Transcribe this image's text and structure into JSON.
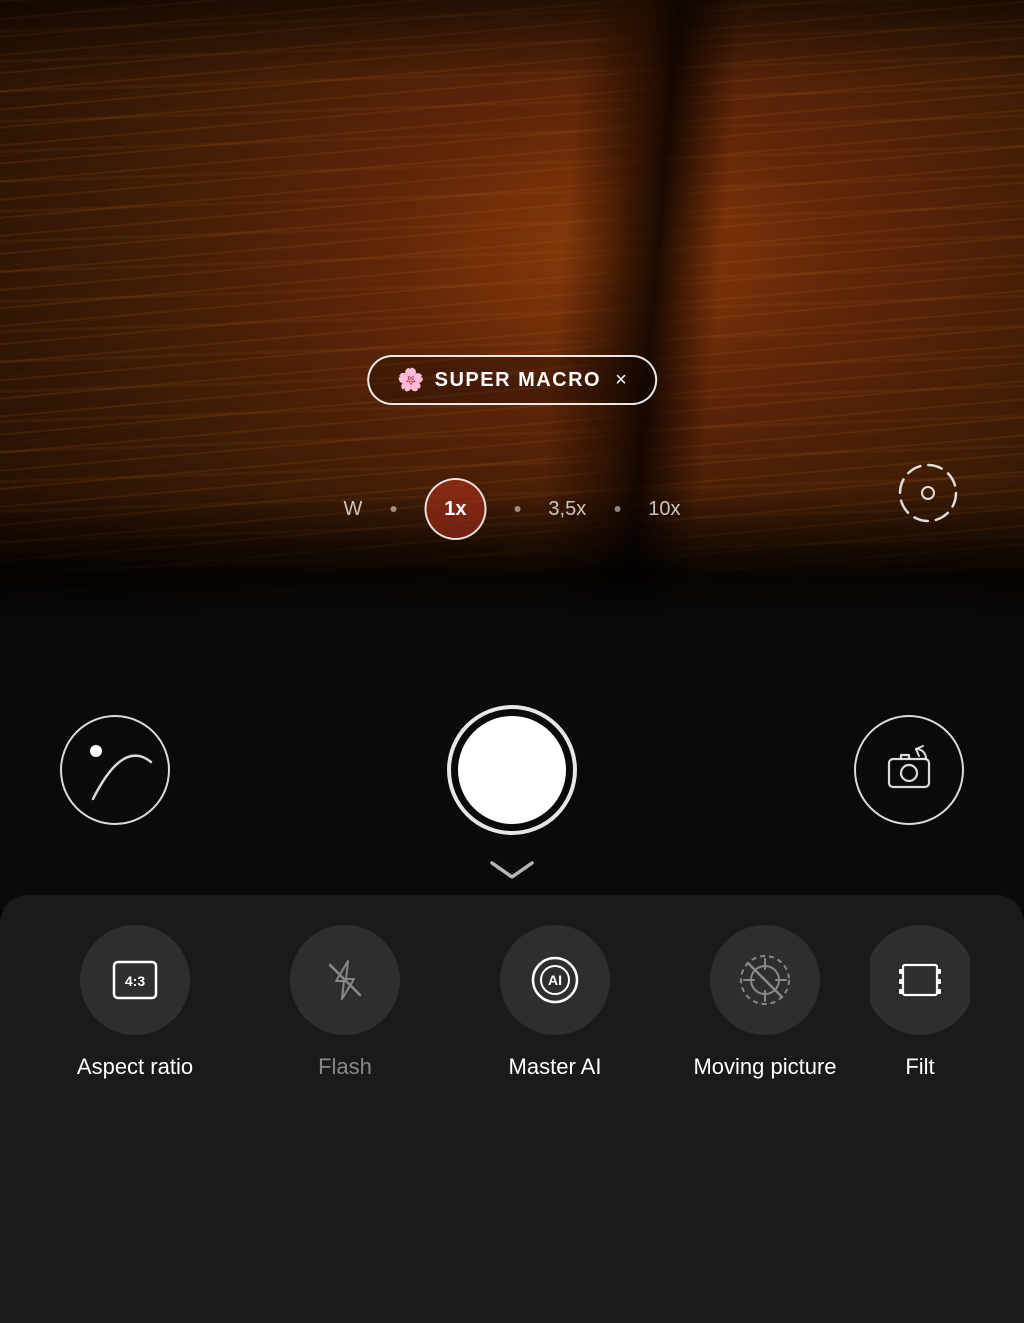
{
  "viewfinder": {
    "mode_badge": {
      "icon": "🌸",
      "text": "SUPER MACRO",
      "close": "×"
    },
    "zoom": {
      "options": [
        "W",
        "1x",
        "3,5x",
        "10x"
      ],
      "active": "1x"
    }
  },
  "controls": {
    "shutter_label": "shutter",
    "gallery_label": "gallery",
    "flip_label": "flip camera"
  },
  "settings": {
    "chevron_label": "collapse",
    "items": [
      {
        "id": "aspect-ratio",
        "icon_label": "4:3",
        "label": "Aspect ratio"
      },
      {
        "id": "flash",
        "icon_label": "flash-off",
        "label": "Flash"
      },
      {
        "id": "master-ai",
        "icon_label": "AI",
        "label": "Master AI"
      },
      {
        "id": "moving-picture",
        "icon_label": "moving-picture",
        "label": "Moving picture"
      },
      {
        "id": "filter",
        "icon_label": "filter",
        "label": "Filt"
      }
    ]
  },
  "colors": {
    "bg_dark": "#0a0a0a",
    "bg_tray": "#1a1a1a",
    "icon_circle": "#2e2e2e",
    "active_zoom_bg": "rgba(180,50,30,0.55)",
    "white": "#ffffff",
    "muted": "#888888"
  }
}
